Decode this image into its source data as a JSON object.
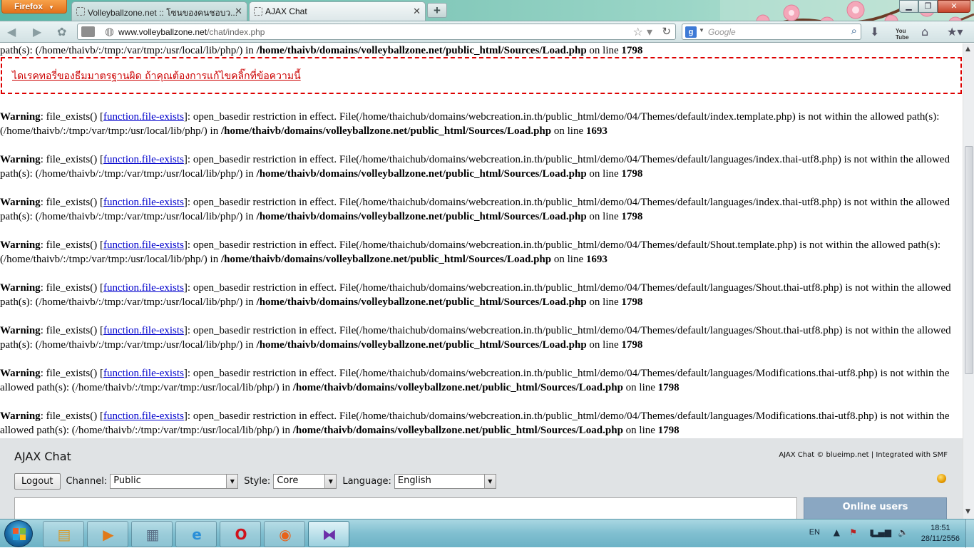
{
  "browser": {
    "menu_button": "Firefox",
    "tabs": [
      {
        "title": "Volleyballzone.net :: โซนของคนชอบว...",
        "active": false
      },
      {
        "title": "AJAX Chat",
        "active": true
      }
    ],
    "new_tab": "+",
    "url_domain": "www.volleyballzone.net",
    "url_path": "/chat/index.php",
    "search_placeholder": "Google"
  },
  "page": {
    "top_line": {
      "text": "path(s): (/home/thaivb/:/tmp:/var/tmp:/usr/local/lib/php/) in ",
      "path": "/home/thaivb/domains/volleyballzone.net/public_html/Sources/Load.php",
      "online": " on line ",
      "line": "1798"
    },
    "redirect_link": "ไดเรคทอรี่ของธีมมาตรฐานผิด ถ้าคุณต้องการแก้ไขคลิ๊กที่ข้อความนี้",
    "warnings": [
      {
        "label": "Warning",
        "func": "file_exists()",
        "link": "function.file-exists",
        "msg": "open_basedir restriction in effect. File(/home/thaichub/domains/webcreation.in.th/public_html/demo/04/Themes/default/index.template.php) is not within the allowed path(s): (/home/thaivb/:/tmp:/var/tmp:/usr/local/lib/php/) in",
        "path": "/home/thaivb/domains/volleyballzone.net/public_html/Sources/Load.php",
        "line": "1693"
      },
      {
        "label": "Warning",
        "func": "file_exists()",
        "link": "function.file-exists",
        "msg": "open_basedir restriction in effect. File(/home/thaichub/domains/webcreation.in.th/public_html/demo/04/Themes/default/languages/index.thai-utf8.php) is not within the allowed path(s): (/home/thaivb/:/tmp:/var/tmp:/usr/local/lib/php/) in",
        "path": "/home/thaivb/domains/volleyballzone.net/public_html/Sources/Load.php",
        "line": "1798"
      },
      {
        "label": "Warning",
        "func": "file_exists()",
        "link": "function.file-exists",
        "msg": "open_basedir restriction in effect. File(/home/thaichub/domains/webcreation.in.th/public_html/demo/04/Themes/default/languages/index.thai-utf8.php) is not within the allowed path(s): (/home/thaivb/:/tmp:/var/tmp:/usr/local/lib/php/) in",
        "path": "/home/thaivb/domains/volleyballzone.net/public_html/Sources/Load.php",
        "line": "1798"
      },
      {
        "label": "Warning",
        "func": "file_exists()",
        "link": "function.file-exists",
        "msg": "open_basedir restriction in effect. File(/home/thaichub/domains/webcreation.in.th/public_html/demo/04/Themes/default/Shout.template.php) is not within the allowed path(s): (/home/thaivb/:/tmp:/var/tmp:/usr/local/lib/php/) in",
        "path": "/home/thaivb/domains/volleyballzone.net/public_html/Sources/Load.php",
        "line": "1693"
      },
      {
        "label": "Warning",
        "func": "file_exists()",
        "link": "function.file-exists",
        "msg": "open_basedir restriction in effect. File(/home/thaichub/domains/webcreation.in.th/public_html/demo/04/Themes/default/languages/Shout.thai-utf8.php) is not within the allowed path(s): (/home/thaivb/:/tmp:/var/tmp:/usr/local/lib/php/) in",
        "path": "/home/thaivb/domains/volleyballzone.net/public_html/Sources/Load.php",
        "line": "1798"
      },
      {
        "label": "Warning",
        "func": "file_exists()",
        "link": "function.file-exists",
        "msg": "open_basedir restriction in effect. File(/home/thaichub/domains/webcreation.in.th/public_html/demo/04/Themes/default/languages/Shout.thai-utf8.php) is not within the allowed path(s): (/home/thaivb/:/tmp:/var/tmp:/usr/local/lib/php/) in",
        "path": "/home/thaivb/domains/volleyballzone.net/public_html/Sources/Load.php",
        "line": "1798"
      },
      {
        "label": "Warning",
        "func": "file_exists()",
        "link": "function.file-exists",
        "msg": "open_basedir restriction in effect. File(/home/thaichub/domains/webcreation.in.th/public_html/demo/04/Themes/default/languages/Modifications.thai-utf8.php) is not within the allowed path(s): (/home/thaivb/:/tmp:/var/tmp:/usr/local/lib/php/) in",
        "path": "/home/thaivb/domains/volleyballzone.net/public_html/Sources/Load.php",
        "line": "1798"
      },
      {
        "label": "Warning",
        "func": "file_exists()",
        "link": "function.file-exists",
        "msg": "open_basedir restriction in effect. File(/home/thaichub/domains/webcreation.in.th/public_html/demo/04/Themes/default/languages/Modifications.thai-utf8.php) is not within the allowed path(s): (/home/thaivb/:/tmp:/var/tmp:/usr/local/lib/php/) in",
        "path": "/home/thaivb/domains/volleyballzone.net/public_html/Sources/Load.php",
        "line": "1798"
      }
    ],
    "on_line_text": "on line"
  },
  "chat": {
    "title": "AJAX Chat",
    "credits": "AJAX Chat © blueimp.net | Integrated with SMF",
    "logout_label": "Logout",
    "channel_label": "Channel:",
    "channel_value": "Public",
    "style_label": "Style:",
    "style_value": "Core",
    "language_label": "Language:",
    "language_value": "English",
    "online_users_label": "Online users",
    "status_color": "#e59b00"
  },
  "taskbar": {
    "items": [
      {
        "name": "explorer-icon",
        "glyph": "▤",
        "color": "#d79b2c"
      },
      {
        "name": "media-player-icon",
        "glyph": "▶",
        "color": "#e07a1a"
      },
      {
        "name": "calculator-icon",
        "glyph": "▦",
        "color": "#5a6f86"
      },
      {
        "name": "internet-explorer-icon",
        "glyph": "e",
        "color": "#2a8fd8"
      },
      {
        "name": "opera-icon",
        "glyph": "O",
        "color": "#d0121b"
      },
      {
        "name": "firefox-icon",
        "glyph": "◉",
        "color": "#e8621a"
      },
      {
        "name": "media-app-icon",
        "glyph": "⧓",
        "color": "#6c2fa8"
      }
    ],
    "language": "EN",
    "time": "18:51",
    "date": "28/11/2556"
  }
}
